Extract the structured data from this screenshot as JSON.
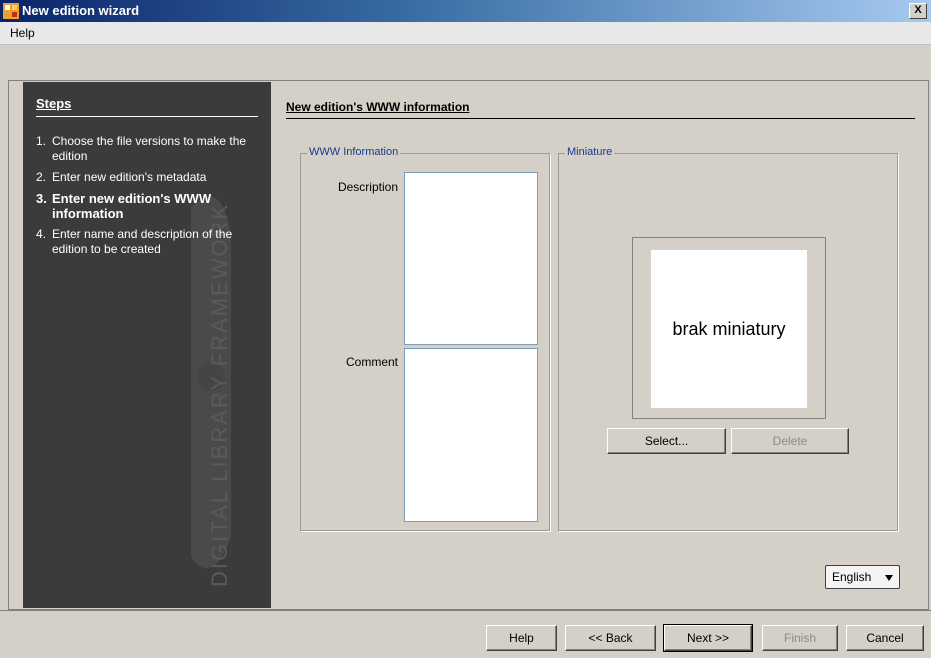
{
  "window": {
    "title": "New edition wizard",
    "close_symbol": "X"
  },
  "menu": {
    "items": [
      {
        "label": "Help"
      }
    ]
  },
  "sidebar": {
    "title": "Steps",
    "steps": [
      {
        "num": "1.",
        "text": "Choose the file versions to make the edition"
      },
      {
        "num": "2.",
        "text": "Enter new edition's metadata"
      },
      {
        "num": "3.",
        "text": "Enter new edition's WWW information"
      },
      {
        "num": "4.",
        "text": "Enter name and description of the edition to be created"
      }
    ],
    "active_step": 3,
    "watermark_text": "DIGITAL LIBRARY FRAMEWORK",
    "watermark_logo": "dLibra"
  },
  "content": {
    "title": "New edition's WWW information",
    "www_group": {
      "legend": "WWW Information",
      "description_label": "Description",
      "comment_label": "Comment",
      "description_value": "",
      "comment_value": ""
    },
    "miniature_group": {
      "legend": "Miniature",
      "placeholder": "brak miniatury",
      "select_label": "Select...",
      "delete_label": "Delete"
    },
    "language": {
      "selected": "English"
    }
  },
  "footer": {
    "help_label": "Help",
    "back_label": "<< Back",
    "next_label": "Next >>",
    "finish_label": "Finish",
    "cancel_label": "Cancel"
  },
  "colors": {
    "title_gradient_start": "#0a246a",
    "sidebar_bg": "#3b3b3b",
    "window_bg": "#d4d0c8",
    "legend_text": "#1a3a8a"
  }
}
